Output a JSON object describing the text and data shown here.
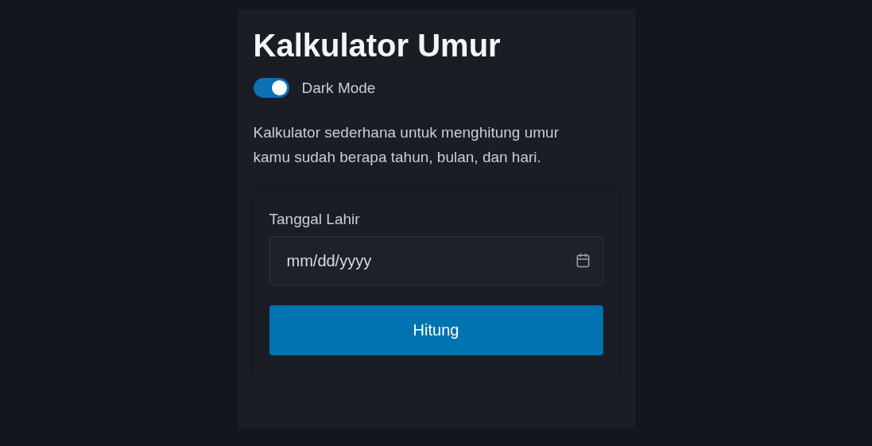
{
  "title": "Kalkulator Umur",
  "dark_mode": {
    "label": "Dark Mode",
    "on": true
  },
  "description": "Kalkulator sederhana untuk menghitung umur kamu sudah berapa tahun, bulan, dan hari.",
  "form": {
    "label": "Tanggal Lahir",
    "placeholder": "mm/dd/yyyy",
    "button": "Hitung"
  }
}
